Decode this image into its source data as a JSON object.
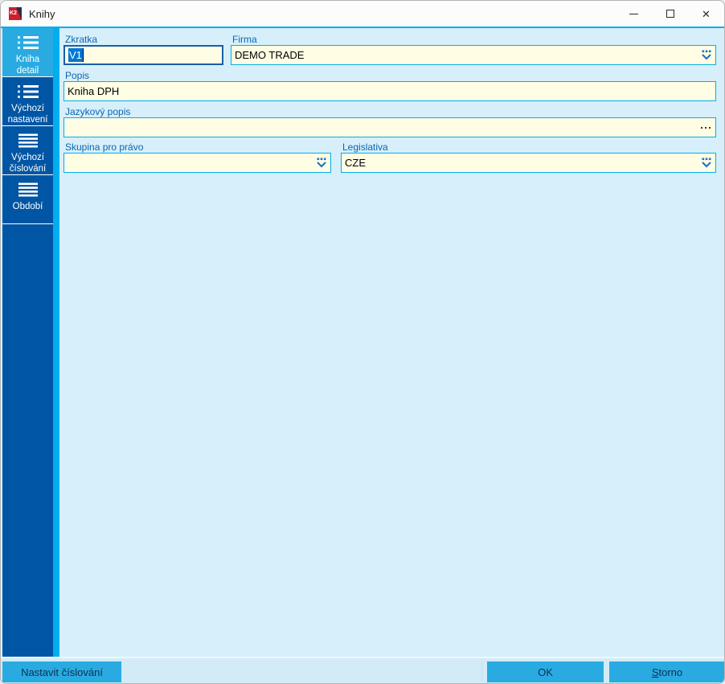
{
  "window": {
    "title": "Knihy",
    "app_logo_text": "K2"
  },
  "titlebar": {
    "buttons": [
      "minimize",
      "maximize",
      "close"
    ]
  },
  "sidebar": {
    "items": [
      {
        "label": "Kniha detail",
        "icon": "bulleted-list-icon",
        "active": true
      },
      {
        "label": "Výchozí nastavení",
        "icon": "bulleted-list-icon",
        "active": false
      },
      {
        "label": "Výchozí číslování",
        "icon": "hamburger-icon",
        "active": false
      },
      {
        "label": "Období",
        "icon": "hamburger-icon",
        "active": false
      }
    ]
  },
  "form": {
    "fields": {
      "zkratka": {
        "label": "Zkratka",
        "value": "V1",
        "state": "focused, text selected"
      },
      "firma": {
        "label": "Firma",
        "value": "DEMO TRADE",
        "control": "lookup-dropdown"
      },
      "popis": {
        "label": "Popis",
        "value": "Kniha DPH"
      },
      "jazykovy_popis": {
        "label": "Jazykový popis",
        "value": "",
        "control": "ellipsis-button"
      },
      "skupina_pro_pravo": {
        "label": "Skupina pro právo",
        "value": "",
        "control": "lookup-dropdown"
      },
      "legislativa": {
        "label": "Legislativa",
        "value": "CZE",
        "control": "lookup-dropdown"
      }
    }
  },
  "footer": {
    "nastavit_cislovani": "Nastavit číslování",
    "ok": "OK",
    "storno_accel": "S",
    "storno_rest": "torno"
  },
  "colors": {
    "sidebar": "#0056A4",
    "sidebar_active": "#29ABE2",
    "accent_strip": "#00AEEF",
    "content_bg": "#D7EFFA",
    "input_bg": "#FFFDE3",
    "input_border": "#00AEEF",
    "focus_border": "#1A5FA8",
    "selection": "#0078D7",
    "label_text": "#0A66B2",
    "button": "#29ABE2"
  }
}
